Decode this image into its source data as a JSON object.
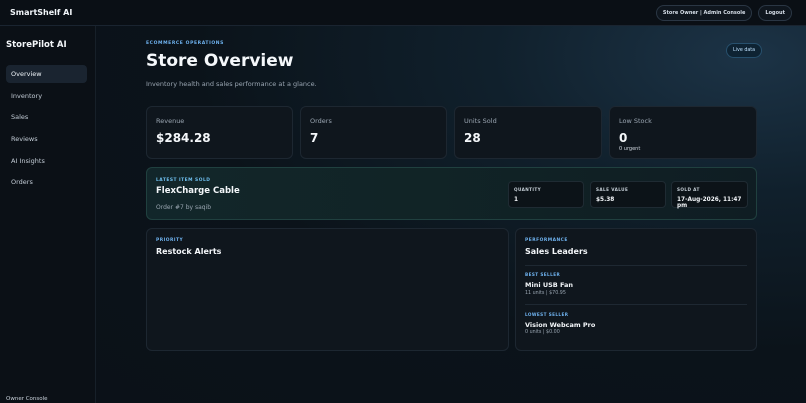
{
  "topbar": {
    "brand": "SmartShelf AI",
    "role_label": "Store Owner | Admin Console",
    "logout_label": "Logout"
  },
  "sidebar": {
    "title": "StorePilot AI",
    "items": [
      {
        "label": "Overview",
        "active": true
      },
      {
        "label": "Inventory",
        "active": false
      },
      {
        "label": "Sales",
        "active": false
      },
      {
        "label": "Reviews",
        "active": false
      },
      {
        "label": "AI Insights",
        "active": false
      },
      {
        "label": "Orders",
        "active": false
      }
    ],
    "footer": "Owner Console"
  },
  "header": {
    "eyebrow": "ECOMMERCE OPERATIONS",
    "title": "Store Overview",
    "subtitle": "Inventory health and sales performance at a glance.",
    "live_badge": "Live data"
  },
  "stats": [
    {
      "label": "Revenue",
      "value": "$284.28",
      "note": ""
    },
    {
      "label": "Orders",
      "value": "7",
      "note": ""
    },
    {
      "label": "Units Sold",
      "value": "28",
      "note": ""
    },
    {
      "label": "Low Stock",
      "value": "0",
      "note": "0 urgent"
    }
  ],
  "latest_item": {
    "eyebrow": "LATEST ITEM SOLD",
    "name": "FlexCharge Cable",
    "subtext": "Order #7 by saqib",
    "details": [
      {
        "label": "QUANTITY",
        "value": "1"
      },
      {
        "label": "SALE VALUE",
        "value": "$5.38"
      },
      {
        "label": "SOLD AT",
        "value": "17-Aug-2026, 11:47 pm"
      }
    ]
  },
  "restock": {
    "eyebrow": "PRIORITY",
    "title": "Restock Alerts"
  },
  "leaders": {
    "eyebrow": "PERFORMANCE",
    "title": "Sales Leaders",
    "best": {
      "eyebrow": "BEST SELLER",
      "name": "Mini USB Fan",
      "meta": "11 units | $70.95"
    },
    "lowest": {
      "eyebrow": "LOWEST SELLER",
      "name": "Vision Webcam Pro",
      "meta": "0 units | $0.00"
    }
  },
  "colors": {
    "accent": "#6fb3f0",
    "background": "#0b1118",
    "card": "#0f161d",
    "highlight_card": "#12262a"
  }
}
